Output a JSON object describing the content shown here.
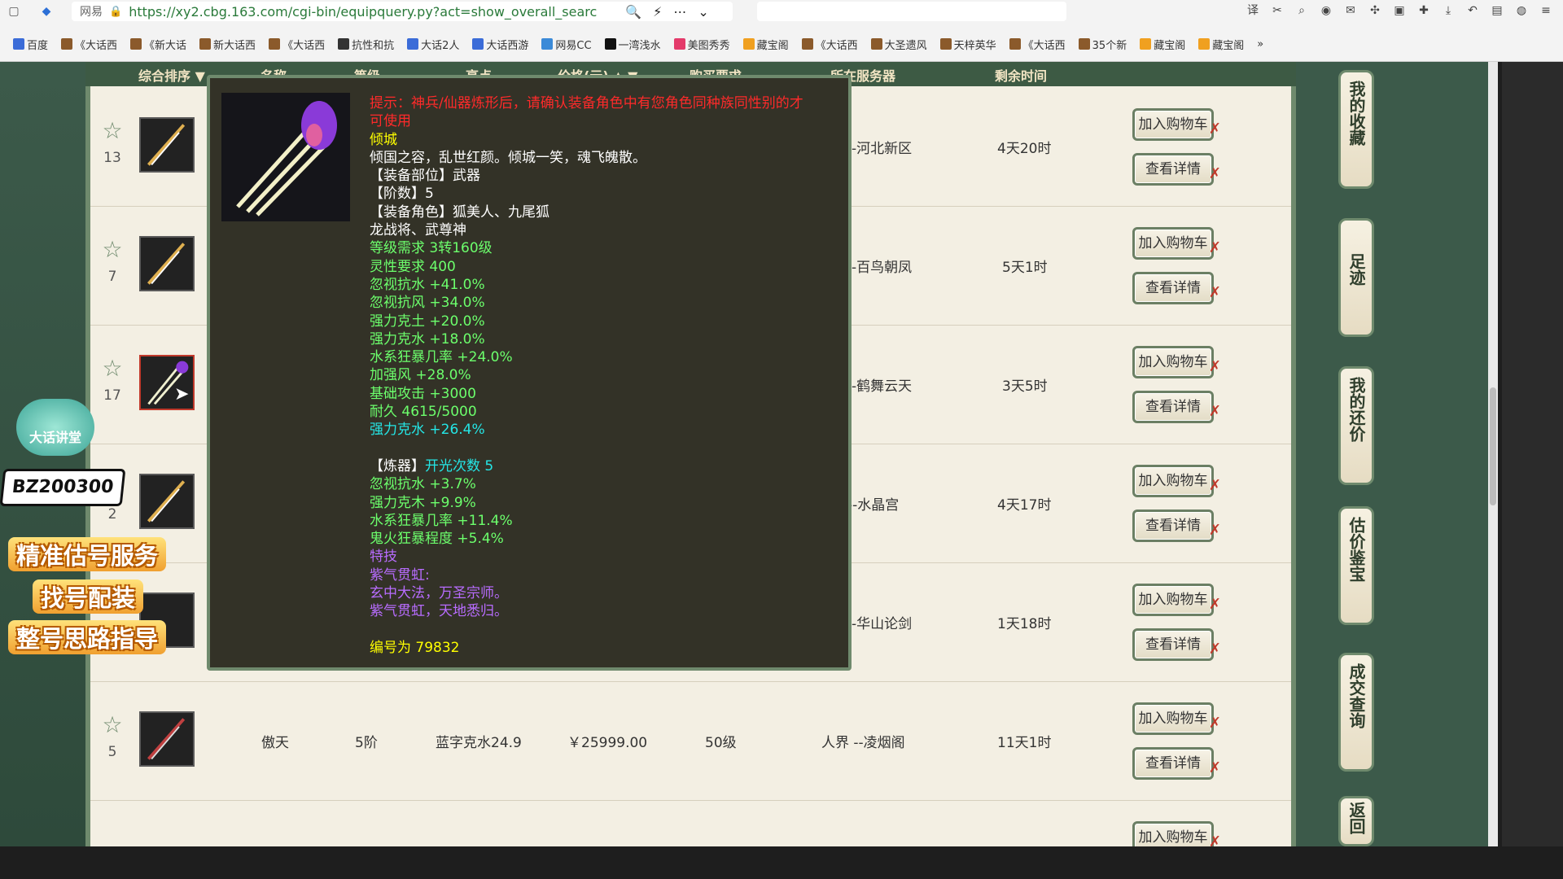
{
  "browser": {
    "site_label": "网易",
    "url": "https://xy2.cbg.163.com/cgi-bin/equipquery.py?act=show_overall_searc",
    "bookmarks": [
      "百度",
      "《大话西",
      "《新大话",
      "新大话西",
      "《大话西",
      "抗性和抗",
      "大话2人",
      "大话西游",
      "网易CC",
      "一湾浅水",
      "美图秀秀",
      "藏宝阁",
      "《大话西",
      "大圣遗风",
      "天梓英华",
      "《大话西",
      "35个新",
      "藏宝阁",
      "藏宝阁"
    ]
  },
  "table": {
    "headers": [
      "综合排序 ▼",
      "名称",
      "等级",
      "亮点",
      "价格(元) ▲ ▼",
      "购买要求",
      "所在服务器",
      "剩余时间"
    ],
    "rows": [
      {
        "fav": "13",
        "server": "-河北新区",
        "time": "4天20时"
      },
      {
        "fav": "7",
        "server": "-百鸟朝凤",
        "time": "5天1时"
      },
      {
        "fav": "17",
        "server": "-鹤舞云天",
        "time": "3天5时"
      },
      {
        "fav": "2",
        "server": "--水晶宫",
        "time": "4天17时"
      },
      {
        "fav": "",
        "server": "-华山论剑",
        "time": "1天18时"
      },
      {
        "fav": "5",
        "name": "傲天",
        "level": "5阶",
        "highlight": "蓝字克水24.9",
        "price": "￥25999.00",
        "req": "50级",
        "server": "人界 --凌烟阁",
        "time": "11天1时"
      }
    ],
    "add_cart": "加入购物车",
    "view_detail": "查看详情"
  },
  "sidebar": {
    "favorites": "我的收藏",
    "footprint": "足迹",
    "counteroffer": "我的还价",
    "appraise": "估价鉴宝",
    "deals": "成交查询",
    "back": "返回"
  },
  "tooltip": {
    "warning": "提示：神兵/仙器炼形后，请确认装备角色中有您角色同种族同性别的才可使用",
    "name": "倾城",
    "desc": "倾国之容，乱世红颜。倾城一笑，魂飞魄散。",
    "slot": "【装备部位】武器",
    "tier": "【阶数】5",
    "roles": "【装备角色】狐美人、九尾狐",
    "roles2": "龙战将、武尊神",
    "level_req": "等级需求 3转160级",
    "spirit_req": "灵性要求 400",
    "stats": [
      "忽视抗水 +41.0%",
      "忽视抗风 +34.0%",
      "强力克土 +20.0%",
      "强力克水 +18.0%",
      "水系狂暴几率 +24.0%",
      "加强风 +28.0%",
      "基础攻击 +3000",
      "耐久 4615/5000"
    ],
    "blue_stat": "强力克水 +26.4%",
    "refine_label": "【炼器】",
    "refine_count": "开光次数 5",
    "refine_stats": [
      "忽视抗水 +3.7%",
      "强力克木 +9.9%",
      "水系狂暴几率 +11.4%",
      "鬼火狂暴程度 +5.4%"
    ],
    "skill_label": "特技",
    "skill_name": "紫气贯虹:",
    "skill_desc1": "玄中大法，万圣宗师。",
    "skill_desc2": "紫气贯虹，天地悉归。",
    "serial": "编号为 79832"
  },
  "ad": {
    "badge": "大话讲堂",
    "code": "BZ200300",
    "line1": "精准估号服务",
    "line2": "找号配装",
    "line3": "整号思路指导"
  }
}
